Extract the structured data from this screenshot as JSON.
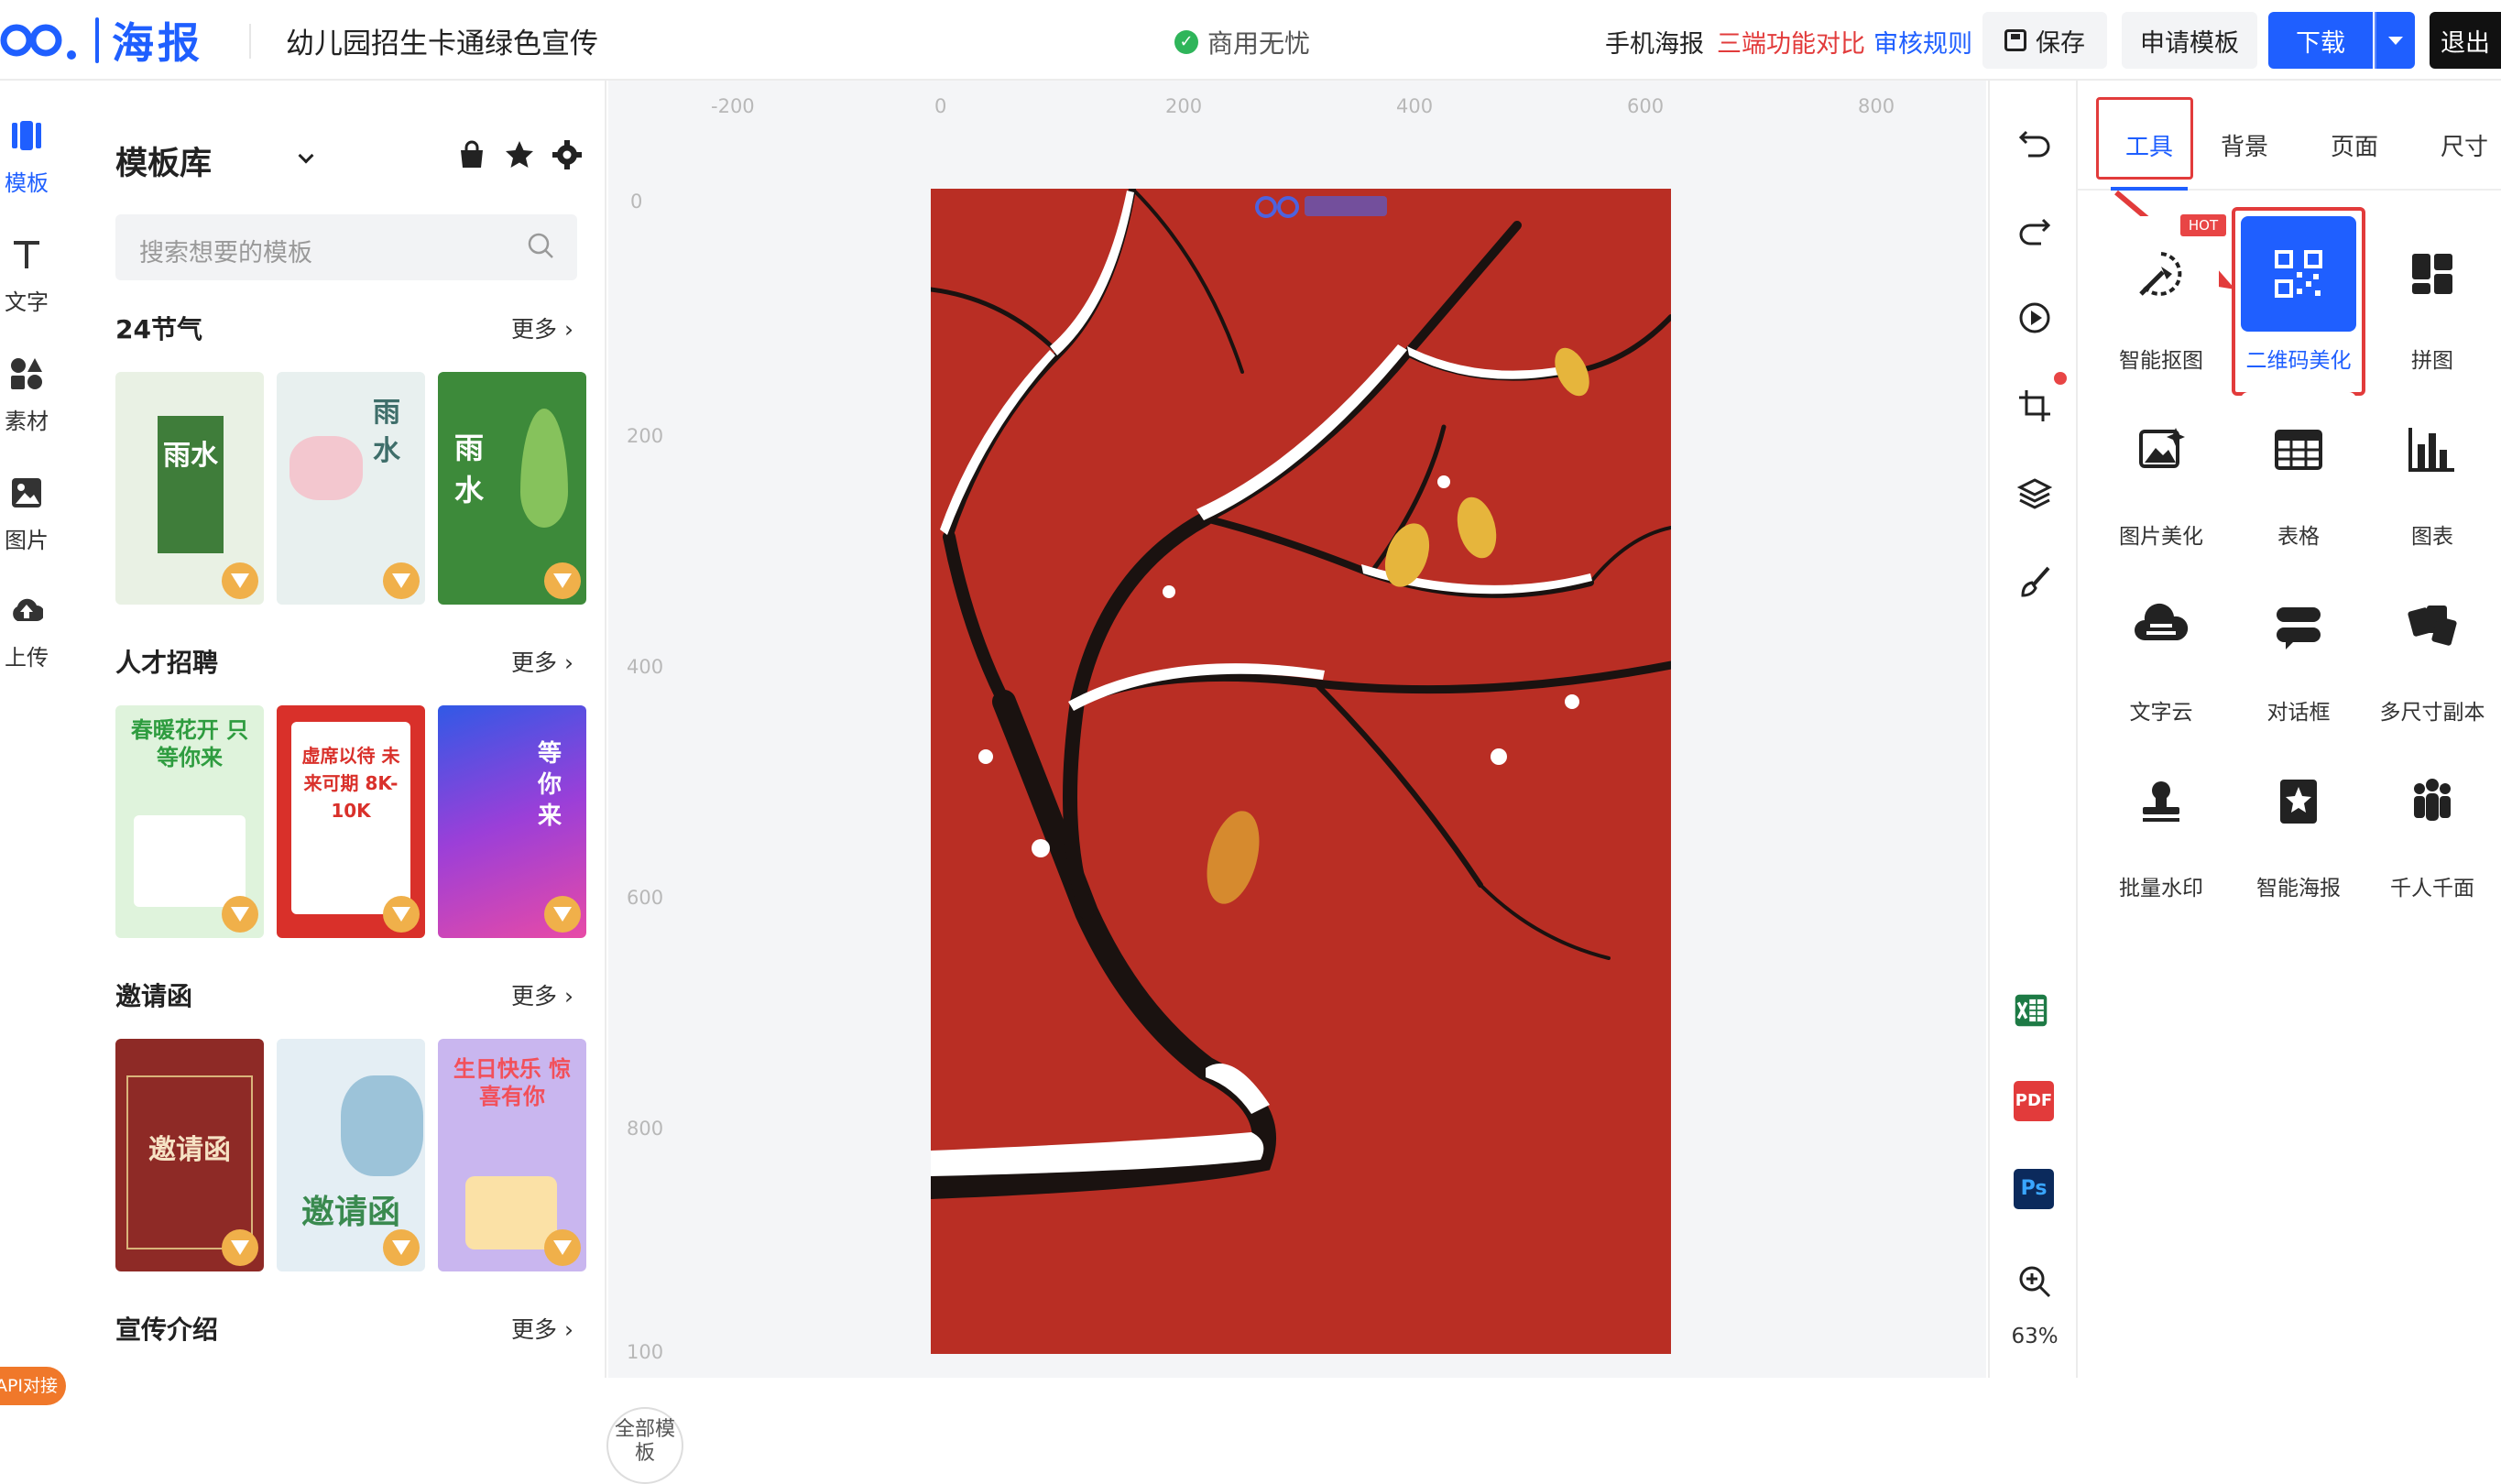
{
  "brand": {
    "logo_text": "海报",
    "accent": "#1f5fff"
  },
  "header": {
    "doc_title": "幼儿园招生卡通绿色宣传",
    "commercial": "商用无忧",
    "links": {
      "mobile": "手机海报",
      "compare": "三端功能对比",
      "rules": "审核规则"
    },
    "buttons": {
      "save": "保存",
      "apply": "申请模板",
      "download": "下载",
      "exit": "退出"
    }
  },
  "left_nav": [
    {
      "label": "模板",
      "icon": "template-icon"
    },
    {
      "label": "文字",
      "icon": "text-icon"
    },
    {
      "label": "素材",
      "icon": "shapes-icon"
    },
    {
      "label": "图片",
      "icon": "image-icon"
    },
    {
      "label": "上传",
      "icon": "upload-icon"
    }
  ],
  "api_badge": "API对接",
  "library": {
    "title": "模板库",
    "search_placeholder": "搜索想要的模板",
    "more": "更多",
    "all_button": "全部模板",
    "sections": [
      {
        "title": "24节气",
        "thumbs": [
          {
            "text": "雨水",
            "bg": "#e9f1e4",
            "fg": "#2f6b36"
          },
          {
            "text": "雨水",
            "bg": "#e8f0ef",
            "fg": "#3e6e6a"
          },
          {
            "text": "雨水",
            "bg": "#3d8a3a",
            "fg": "#ffffff"
          }
        ]
      },
      {
        "title": "人才招聘",
        "thumbs": [
          {
            "text": "春暖花开 只等你来",
            "bg": "#dff3dc",
            "fg": "#2e9c3f"
          },
          {
            "text": "虚席以待 未来可期 8K-10K",
            "bg": "#d9302a",
            "fg": "#ffffff"
          },
          {
            "text": "等你来",
            "bg": "#6a3ed6",
            "fg": "#ffffff"
          }
        ]
      },
      {
        "title": "邀请函",
        "thumbs": [
          {
            "text": "邀请函",
            "bg": "#8e2a26",
            "fg": "#f6e2c4"
          },
          {
            "text": "邀请函",
            "bg": "#e4eef4",
            "fg": "#3a8a4f"
          },
          {
            "text": "生日快乐 惊喜有你",
            "bg": "#c9b6ef",
            "fg": "#f2505a"
          }
        ]
      },
      {
        "title": "宣传介绍",
        "thumbs": []
      }
    ]
  },
  "canvas": {
    "ruler_h": [
      "-200",
      "0",
      "200",
      "400",
      "600",
      "800"
    ],
    "ruler_v": [
      "0",
      "200",
      "400",
      "600",
      "800",
      "100"
    ],
    "poster_bg": "#b92e24"
  },
  "tool_strip": [
    "undo-icon",
    "redo-icon",
    "play-icon",
    "crop-icon",
    "layers-icon",
    "brush-icon",
    "excel-icon",
    "pdf-icon",
    "photoshop-icon",
    "zoom-in-icon"
  ],
  "tool_strip_labels": {
    "pdf": "PDF",
    "ps": "Ps"
  },
  "zoom": "63%",
  "right_panel": {
    "tabs": [
      "工具",
      "背景",
      "页面",
      "尺寸"
    ],
    "hot_badge": "HOT",
    "tools": [
      {
        "label": "智能抠图",
        "icon": "smart-cutout-icon"
      },
      {
        "label": "二维码美化",
        "icon": "qrcode-icon",
        "selected": true
      },
      {
        "label": "拼图",
        "icon": "collage-icon"
      },
      {
        "label": "图片美化",
        "icon": "image-enhance-icon"
      },
      {
        "label": "表格",
        "icon": "table-icon"
      },
      {
        "label": "图表",
        "icon": "chart-icon"
      },
      {
        "label": "文字云",
        "icon": "word-cloud-icon"
      },
      {
        "label": "对话框",
        "icon": "dialog-icon"
      },
      {
        "label": "多尺寸副本",
        "icon": "multi-size-icon"
      },
      {
        "label": "批量水印",
        "icon": "batch-watermark-icon"
      },
      {
        "label": "智能海报",
        "icon": "smart-poster-icon"
      },
      {
        "label": "千人千面",
        "icon": "personalize-icon"
      }
    ]
  }
}
